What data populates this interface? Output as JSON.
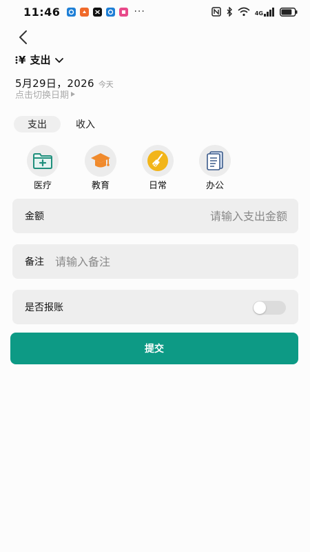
{
  "status_bar": {
    "time": "11:46",
    "more": "···",
    "network": "4G",
    "battery_percent": 0.8
  },
  "header": {
    "type_icon": "¥",
    "type_label": "支出",
    "date": "5月29日，2026",
    "today": "今天",
    "switch_hint": "点击切换日期"
  },
  "tabs": [
    {
      "label": "支出",
      "selected": true
    },
    {
      "label": "收入",
      "selected": false
    }
  ],
  "categories": [
    {
      "label": "医疗",
      "icon": "medical-folder-icon",
      "color": "#1f8f7c"
    },
    {
      "label": "教育",
      "icon": "graduation-cap-icon",
      "color": "#f08a2c"
    },
    {
      "label": "日常",
      "icon": "broom-icon",
      "color": "#f2b51a"
    },
    {
      "label": "办公",
      "icon": "document-icon",
      "color": "#3a5a8a"
    }
  ],
  "form": {
    "amount_label": "金额",
    "amount_placeholder": "请输入支出金额",
    "note_label": "备注",
    "note_placeholder": "请输入备注",
    "reimburse_label": "是否报账",
    "reimburse_on": false
  },
  "submit_label": "提交",
  "colors": {
    "accent": "#0d9a85",
    "card_bg": "#eeeeee"
  }
}
